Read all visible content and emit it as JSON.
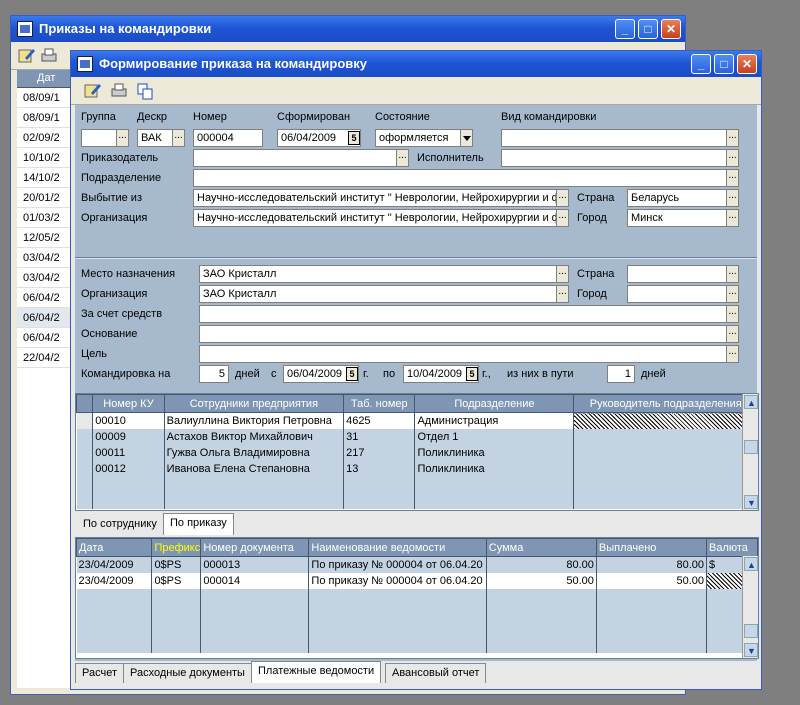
{
  "back_window": {
    "title": "Приказы на командировки",
    "header": "Дат",
    "rows": [
      "08/09/1",
      "08/09/1",
      "02/09/2",
      "10/10/2",
      "14/10/2",
      "20/01/2",
      "01/03/2",
      "12/05/2",
      "03/04/2",
      "03/04/2",
      "06/04/2",
      "06/04/2",
      "06/04/2",
      "22/04/2"
    ]
  },
  "main_window": {
    "title": "Формирование приказа на командировку"
  },
  "top_form": {
    "labels": {
      "group": "Группа",
      "descr": "Дескр",
      "number": "Номер",
      "formed": "Сформирован",
      "state": "Состояние",
      "kind": "Вид командировки",
      "orderer": "Приказодатель",
      "executor": "Исполнитель",
      "dept": "Подразделение",
      "from": "Выбытие из",
      "country": "Страна",
      "org": "Организация",
      "city": "Город"
    },
    "values": {
      "group": "",
      "descr": "ВАК",
      "number": "000004",
      "formed": "06/04/2009",
      "state": "оформляется",
      "kind": "",
      "orderer": "",
      "executor": "",
      "dept": "",
      "from": "Научно-исследовательский институт \" Неврологии, Нейрохирургии и ф",
      "country": "Беларусь",
      "org": "Научно-исследовательский институт \" Неврологии, Нейрохирургии и ф",
      "city": "Минск"
    }
  },
  "dest_form": {
    "labels": {
      "place": "Место назначения",
      "country": "Страна",
      "org": "Организация",
      "city": "Город",
      "funds": "За счет средств",
      "basis": "Основание",
      "goal": "Цель",
      "trip": "Командировка на",
      "days": "дней",
      "from": "с",
      "g1": "г.",
      "to": "по",
      "g2": "г.,",
      "of_them": "из них в пути",
      "days2": "дней"
    },
    "values": {
      "place": "ЗАО Кристалл",
      "country": "",
      "org": "ЗАО Кристалл",
      "city": "",
      "funds": "",
      "basis": "",
      "goal": "",
      "days": "5",
      "date_from": "06/04/2009",
      "date_to": "10/04/2009",
      "road_days": "1"
    }
  },
  "employees": {
    "headers": [
      "Номер КУ",
      "Сотрудники предприятия",
      "Таб. номер",
      "Подразделение",
      "Руководитель подразделения"
    ],
    "rows": [
      {
        "ku": "00010",
        "name": "Валиуллина Виктория Петровна",
        "tab": "4625",
        "dept": "Администрация",
        "head": ""
      },
      {
        "ku": "00009",
        "name": "Астахов Виктор Михайлович",
        "tab": "31",
        "dept": "Отдел 1",
        "head": ""
      },
      {
        "ku": "00011",
        "name": "Гужва Ольга Владимировна",
        "tab": "217",
        "dept": "Поликлиника",
        "head": ""
      },
      {
        "ku": "00012",
        "name": "Иванова Елена Степановна",
        "tab": "13",
        "dept": "Поликлиника",
        "head": ""
      }
    ]
  },
  "mid_tabs": [
    "По сотруднику",
    "По приказу"
  ],
  "payments": {
    "headers": [
      "Дата",
      "Префикс",
      "Номер документа",
      "Наименование ведомости",
      "Сумма",
      "Выплачено",
      "Валюта"
    ],
    "prefix_color": "#ffff00",
    "rows": [
      {
        "date": "23/04/2009",
        "prefix": "0$PS",
        "doc": "000013",
        "name": "По приказу № 000004 от 06.04.20",
        "sum": "80.00",
        "paid": "80.00",
        "cur": "$"
      },
      {
        "date": "23/04/2009",
        "prefix": "0$PS",
        "doc": "000014",
        "name": "По приказу № 000004 от 06.04.20",
        "sum": "50.00",
        "paid": "50.00",
        "cur": ""
      }
    ]
  },
  "bottom_tabs": [
    "Расчет",
    "Расходные документы",
    "Платежные ведомости",
    "Авансовый отчет"
  ]
}
